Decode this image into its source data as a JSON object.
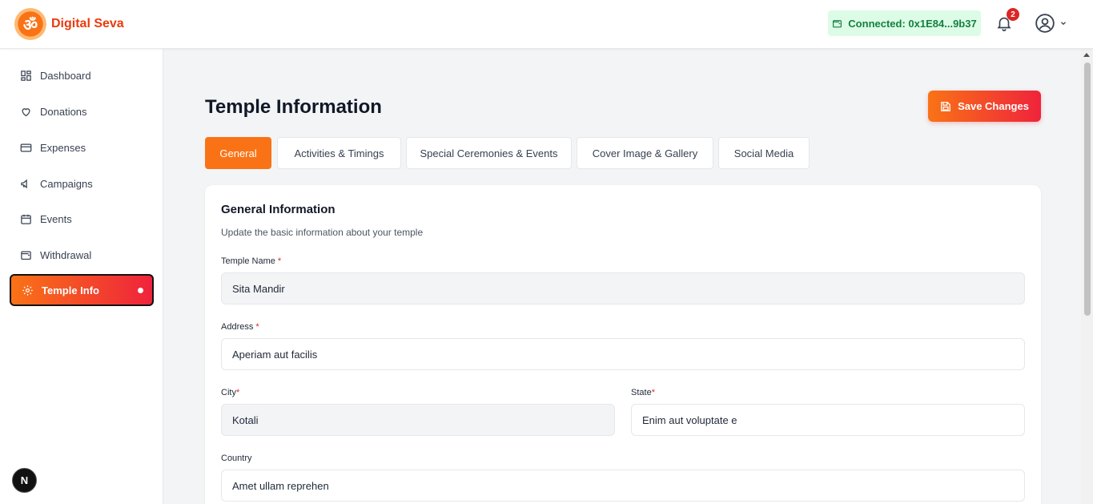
{
  "app": {
    "name": "Digital Seva",
    "logo_glyph": "ॐ"
  },
  "header": {
    "wallet_status": "Connected: 0x1E84...9b37",
    "notification_count": "2"
  },
  "sidebar": {
    "items": [
      {
        "label": "Dashboard",
        "icon": "dashboard-icon"
      },
      {
        "label": "Donations",
        "icon": "heart-icon"
      },
      {
        "label": "Expenses",
        "icon": "credit-card-icon"
      },
      {
        "label": "Campaigns",
        "icon": "megaphone-icon"
      },
      {
        "label": "Events",
        "icon": "calendar-icon"
      },
      {
        "label": "Withdrawal",
        "icon": "wallet-icon"
      },
      {
        "label": "Temple Info",
        "icon": "gear-icon",
        "active": true
      }
    ],
    "footer_badge": "N"
  },
  "main": {
    "title": "Temple Information",
    "save_label": "Save Changes",
    "tabs": [
      {
        "label": "General",
        "active": true
      },
      {
        "label": "Activities & Timings"
      },
      {
        "label": "Special Ceremonies & Events"
      },
      {
        "label": "Cover Image & Gallery"
      },
      {
        "label": "Social Media"
      }
    ],
    "section": {
      "title": "General Information",
      "subtitle": "Update the basic information about your temple"
    },
    "fields": {
      "temple_name": {
        "label": "Temple Name",
        "required_mark": "*",
        "value": "Sita Mandir"
      },
      "address": {
        "label": "Address",
        "required_mark": "*",
        "value": "Aperiam aut facilis"
      },
      "city": {
        "label": "City",
        "required_mark": "*",
        "value": "Kotali"
      },
      "state": {
        "label": "State",
        "required_mark": "*",
        "value": "Enim aut voluptate e"
      },
      "country": {
        "label": "Country",
        "value": "Amet ullam reprehen"
      }
    }
  },
  "colors": {
    "accent_orange": "#f97316",
    "accent_red": "#ef233c",
    "connected_bg": "#dcfce7",
    "connected_text": "#15803d"
  }
}
